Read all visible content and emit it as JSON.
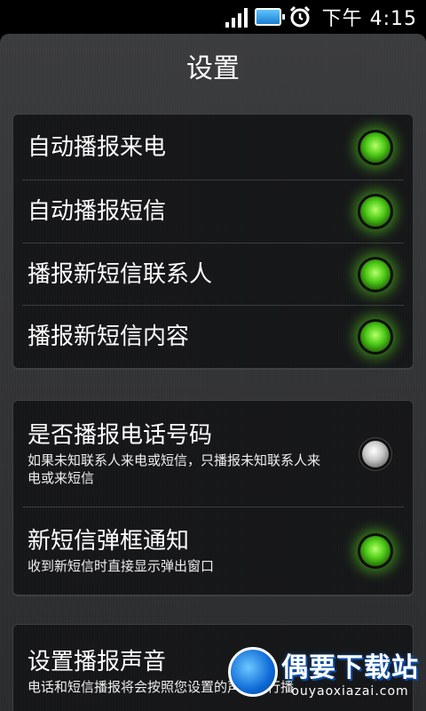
{
  "status": {
    "time": "下午 4:15"
  },
  "header": {
    "title": "设置"
  },
  "group1": {
    "items": [
      {
        "label": "自动播报来电",
        "on": true
      },
      {
        "label": "自动播报短信",
        "on": true
      },
      {
        "label": "播报新短信联系人",
        "on": true
      },
      {
        "label": "播报新短信内容",
        "on": true
      }
    ]
  },
  "group2": {
    "items": [
      {
        "label": "是否播报电话号码",
        "desc": "如果未知联系人来电或短信，只播报未知联系人来电或来短信",
        "on": false
      },
      {
        "label": "新短信弹框通知",
        "desc": "收到新短信时直接显示弹出窗口",
        "on": true
      }
    ]
  },
  "group3": {
    "items": [
      {
        "label": "设置播报声音",
        "desc": "电话和短信播报将会按照您设置的声音进行播"
      }
    ]
  },
  "watermark": {
    "cn": "偶要下载站",
    "en": "ouyaoxiazai.com"
  },
  "colors": {
    "led_on": "#4ecc18",
    "battery": "#1a7fd1"
  }
}
